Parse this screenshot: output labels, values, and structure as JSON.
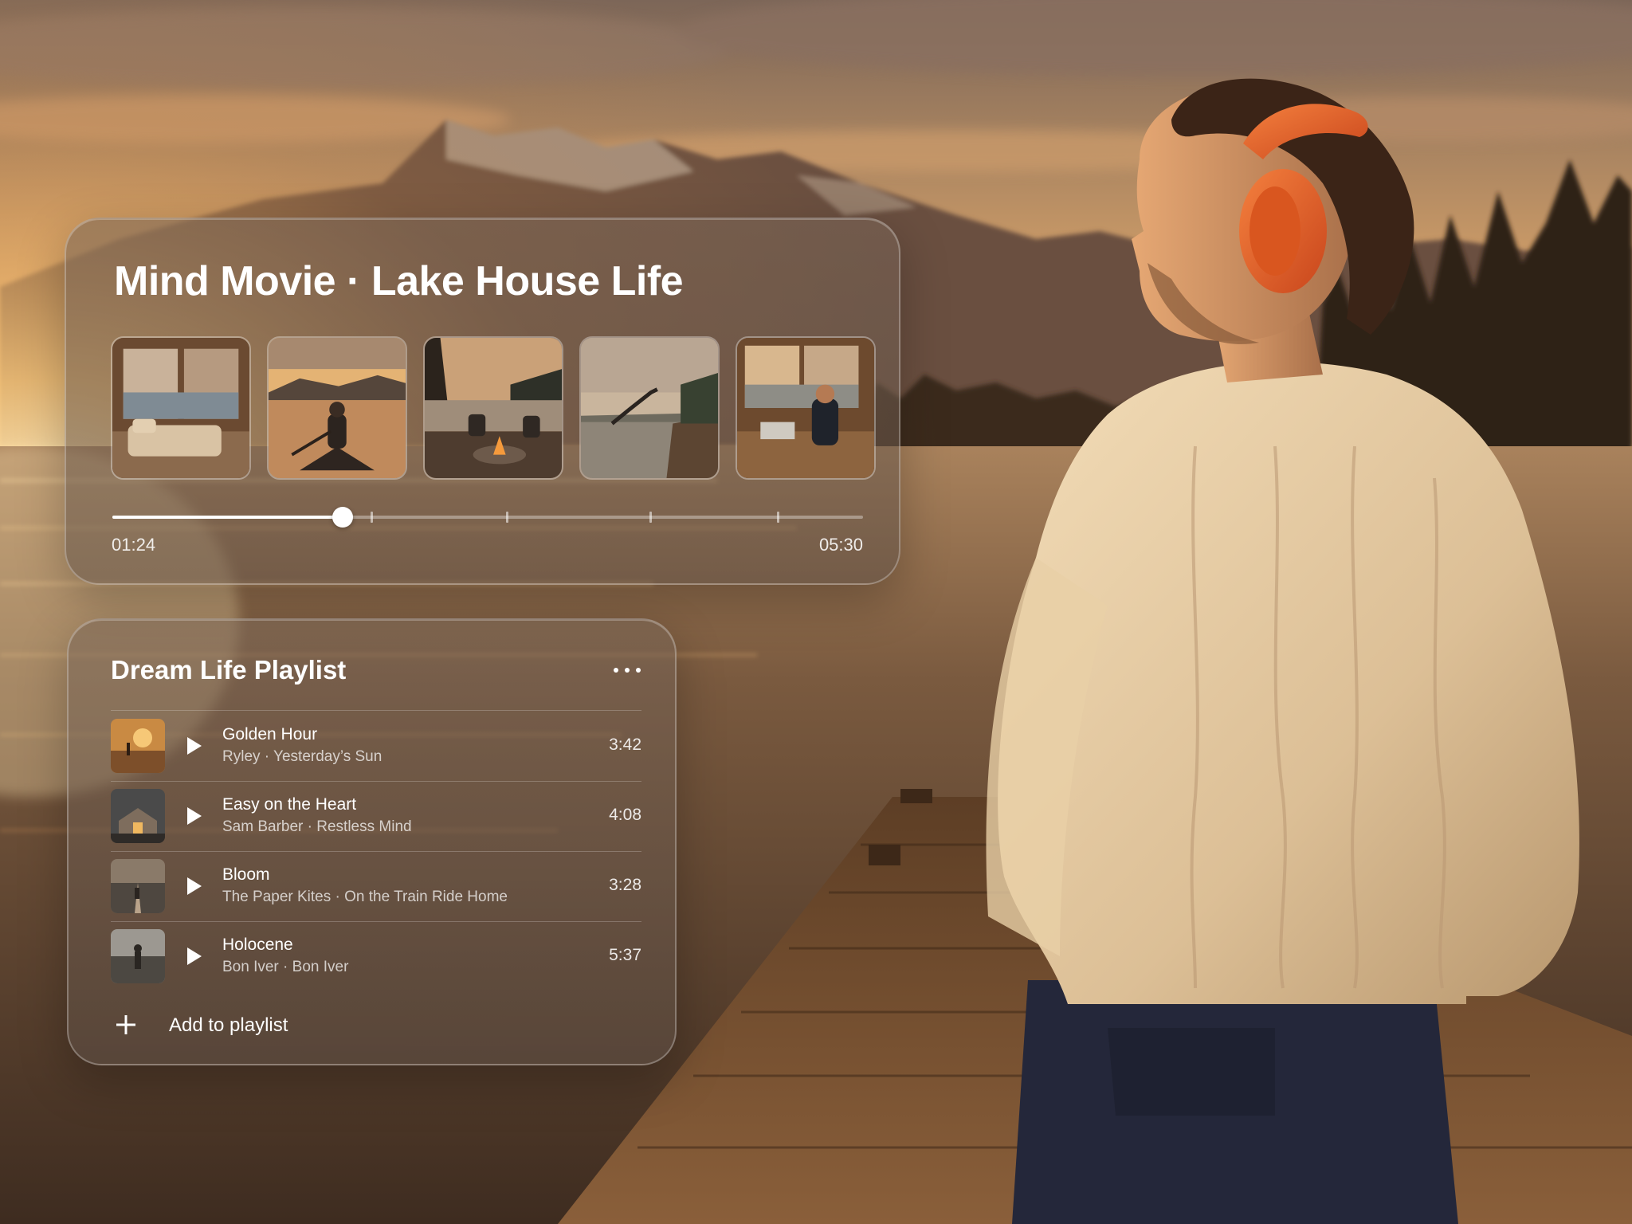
{
  "mind_movie": {
    "title": "Mind Movie · Lake House Life",
    "scenes": [
      {
        "name": "lake-house-bedroom"
      },
      {
        "name": "canoe-on-lake"
      },
      {
        "name": "campfire-on-deck"
      },
      {
        "name": "dive-off-dock"
      },
      {
        "name": "working-by-window"
      }
    ],
    "elapsed": "01:24",
    "total": "05:30",
    "progress": 0.307
  },
  "playlist": {
    "title": "Dream Life Playlist",
    "tracks": [
      {
        "title": "Golden Hour",
        "subtitle": "Ryley · Yesterday’s Sun",
        "duration": "3:42"
      },
      {
        "title": "Easy on the Heart",
        "subtitle": "Sam Barber · Restless Mind",
        "duration": "4:08"
      },
      {
        "title": "Bloom",
        "subtitle": "The Paper Kites · On the Train Ride Home",
        "duration": "3:28"
      },
      {
        "title": "Holocene",
        "subtitle": "Bon Iver · Bon Iver",
        "duration": "5:37"
      }
    ],
    "add_label": "Add to playlist"
  },
  "theme": {
    "accent": "#ffffff",
    "headphones": "#e8622a"
  }
}
